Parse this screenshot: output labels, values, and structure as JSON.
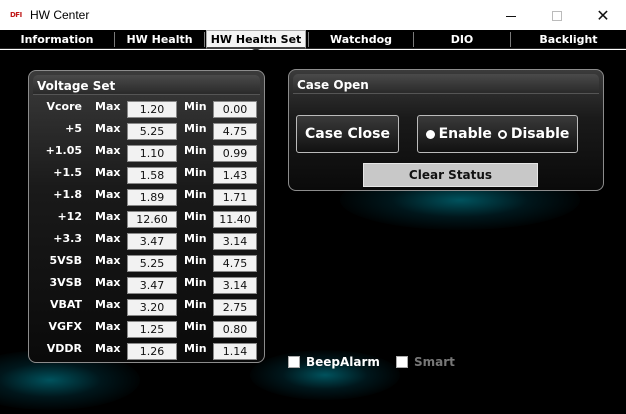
{
  "window": {
    "logo_text": "DFI",
    "title": "HW Center",
    "minimize_glyph": "—",
    "maximize_glyph": "☐",
    "close_glyph": "✕"
  },
  "tabs": [
    {
      "label": "Information",
      "active": false
    },
    {
      "label": "HW Health",
      "active": false
    },
    {
      "label": "HW Health Set",
      "active": true
    },
    {
      "label": "Watchdog",
      "active": false
    },
    {
      "label": "DIO",
      "active": false
    },
    {
      "label": "Backlight",
      "active": false
    }
  ],
  "voltage_set": {
    "title": "Voltage Set",
    "max_label": "Max",
    "min_label": "Min",
    "rows": [
      {
        "name": "Vcore",
        "max": "1.20",
        "min": "0.00"
      },
      {
        "name": "+5",
        "max": "5.25",
        "min": "4.75"
      },
      {
        "name": "+1.05",
        "max": "1.10",
        "min": "0.99"
      },
      {
        "name": "+1.5",
        "max": "1.58",
        "min": "1.43"
      },
      {
        "name": "+1.8",
        "max": "1.89",
        "min": "1.71"
      },
      {
        "name": "+12",
        "max": "12.60",
        "min": "11.40"
      },
      {
        "name": "+3.3",
        "max": "3.47",
        "min": "3.14"
      },
      {
        "name": "5VSB",
        "max": "5.25",
        "min": "4.75"
      },
      {
        "name": "3VSB",
        "max": "3.47",
        "min": "3.14"
      },
      {
        "name": "VBAT",
        "max": "3.20",
        "min": "2.75"
      },
      {
        "name": "VGFX",
        "max": "1.25",
        "min": "0.80"
      },
      {
        "name": "VDDR",
        "max": "1.26",
        "min": "1.14"
      }
    ]
  },
  "case_open": {
    "title": "Case Open",
    "case_close_label": "Case Close",
    "enable_label": "Enable",
    "disable_label": "Disable",
    "selected": "Enable",
    "clear_status_label": "Clear Status"
  },
  "beep_alarm": {
    "label": "BeepAlarm",
    "checked": false,
    "enabled": true
  },
  "smart": {
    "label": "Smart",
    "checked": false,
    "enabled": false
  },
  "colors": {
    "background": "#000000",
    "text": "#ffffff",
    "disabled_text": "#777777",
    "glow": "#00a0b0",
    "logo": "#c01a1a"
  }
}
